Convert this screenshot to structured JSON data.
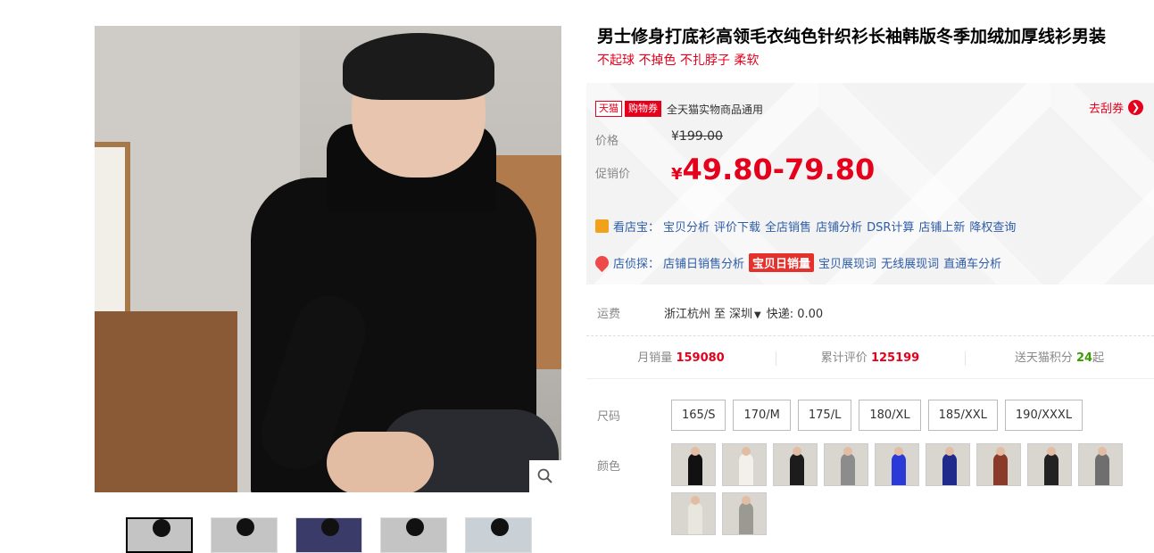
{
  "product": {
    "title": "男士修身打底衫高领毛衣纯色针织衫长袖韩版冬季加绒加厚线衫男装",
    "subtitle": "不起球 不掉色 不扎脖子 柔软"
  },
  "gallery": {
    "zoom_icon": "magnifier-icon",
    "thumbnails": [
      "thumb-1",
      "thumb-2",
      "thumb-3",
      "thumb-4",
      "thumb-5"
    ],
    "active_index": 0
  },
  "coupon": {
    "tag_tmall": "天猫",
    "tag_coupon": "购物券",
    "text": "全天猫实物商品通用",
    "link": "去刮券"
  },
  "price": {
    "label": "价格",
    "currency": "¥",
    "original": "199.00",
    "promo_label": "促销价",
    "promo": "49.80-79.80"
  },
  "tools": {
    "shop_label": "看店宝：",
    "shop_links": [
      "宝贝分析",
      "评价下载",
      "全店销售",
      "店铺分析",
      "DSR计算",
      "店铺上新",
      "降权查询"
    ],
    "detect_label": "店侦探：",
    "detect_links": [
      "店铺日销售分析",
      "宝贝日销量",
      "宝贝展现词",
      "无线展现词",
      "直通车分析"
    ],
    "detect_highlight_index": 1
  },
  "shipping": {
    "label": "运费",
    "from": "浙江杭州",
    "to_word": "至",
    "to": "深圳",
    "express": "快递: 0.00"
  },
  "stats": {
    "monthly_label": "月销量",
    "monthly_value": "159080",
    "reviews_label": "累计评价",
    "reviews_value": "125199",
    "points_label": "送天猫积分",
    "points_value": "24",
    "points_suffix": "起"
  },
  "sku": {
    "size_label": "尺码",
    "sizes": [
      "165/S",
      "170/M",
      "175/L",
      "180/XL",
      "185/XXL",
      "190/XXXL"
    ],
    "color_label": "颜色",
    "color_swatches": [
      "#111111",
      "#f1f0ea",
      "#1c1c1c",
      "#8c8c8c",
      "#2b3ad6",
      "#1f2a8a",
      "#8a3a28",
      "#222222",
      "#6f6f6f",
      "#e9e6de",
      "#9a9a92"
    ]
  },
  "colors": {
    "accent": "#e5001c",
    "link": "#2e5da8",
    "points": "#3c9b00"
  }
}
